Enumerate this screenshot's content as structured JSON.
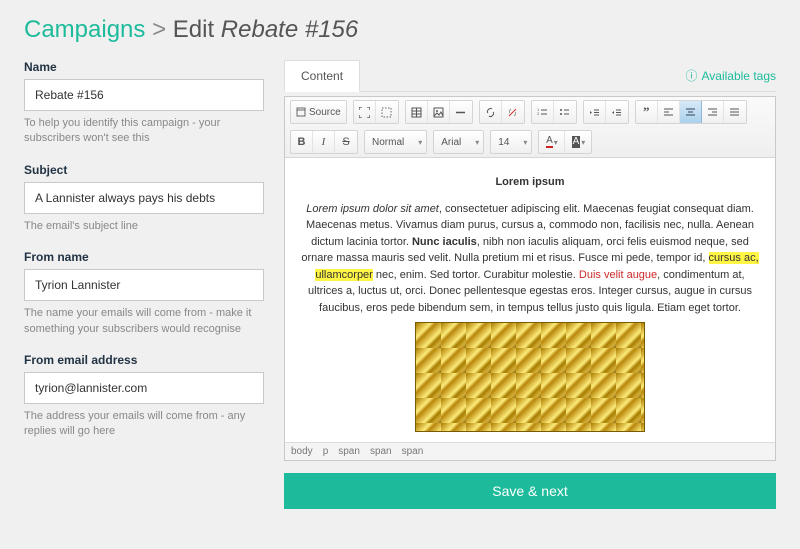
{
  "breadcrumb": {
    "root": "Campaigns",
    "sep": ">",
    "action": "Edit",
    "subject": "Rebate #156"
  },
  "left": {
    "name": {
      "label": "Name",
      "value": "Rebate #156",
      "help": "To help you identify this campaign - your subscribers won't see this"
    },
    "subject": {
      "label": "Subject",
      "value": "A Lannister always pays his debts",
      "help": "The email's subject line"
    },
    "fromname": {
      "label": "From name",
      "value": "Tyrion Lannister",
      "help": "The name your emails will come from - make it something your subscribers would recognise"
    },
    "fromemail": {
      "label": "From email address",
      "value": "tyrion@lannister.com",
      "help": "The address your emails will come from - any replies will go here"
    }
  },
  "tabs": {
    "content": "Content",
    "tagslink": "Available tags"
  },
  "toolbar": {
    "source": "Source",
    "format_select": "Normal",
    "font_select": "Arial",
    "size_select": "14",
    "letter_a": "A"
  },
  "editor": {
    "title": "Lorem ipsum",
    "p1a": "Lorem ipsum dolor sit amet",
    "p1b": ", consectetuer adipiscing elit. Maecenas feugiat consequat diam. Maecenas metus. Vivamus diam purus, cursus a, commodo non, facilisis nec, nulla. Aenean dictum lacinia tortor. ",
    "p1c": "Nunc iaculis",
    "p1d": ", nibh non iaculis aliquam, orci felis euismod neque, sed ornare massa mauris sed velit. Nulla pretium mi et risus. Fusce mi pede, tempor id, ",
    "p1e": "cursus ac, ullamcorper",
    "p1f": " nec, enim. Sed tortor. Curabitur molestie. ",
    "p1g": "Duis velit augue",
    "p1h": ", condimentum at, ultrices a, luctus ut, orci. Donec pellentesque egestas eros. Integer cursus, augue in cursus faucibus, eros pede bibendum sem, in tempus tellus justo quis ligula. Etiam eget tortor."
  },
  "path": [
    "body",
    "p",
    "span",
    "span",
    "span"
  ],
  "save": "Save & next"
}
